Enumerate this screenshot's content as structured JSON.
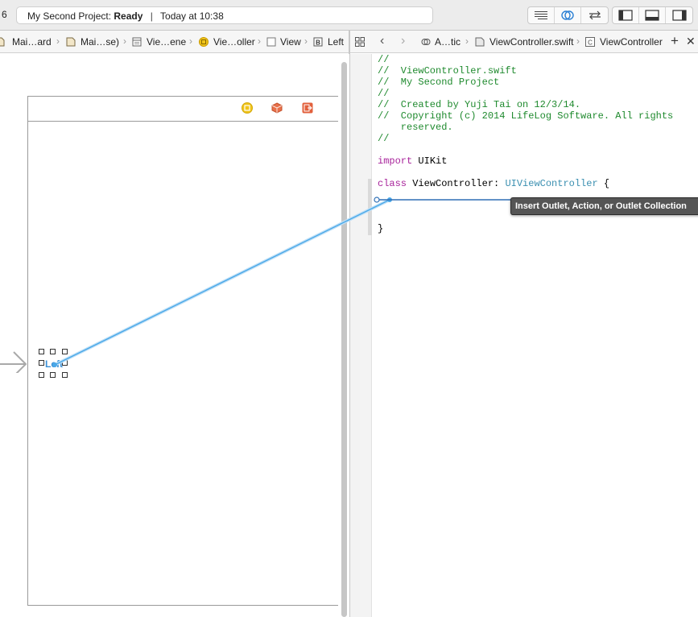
{
  "toolbar": {
    "scheme_number": "6",
    "status_project": "My Second Project:",
    "status_state": "Ready",
    "status_separator": "|",
    "status_time": "Today at 10:38"
  },
  "jumpbar_left": {
    "crumbs": [
      "Mai…ard",
      "Mai…se)",
      "Vie…ene",
      "Vie…oller",
      "View",
      "Left"
    ]
  },
  "jumpbar_right": {
    "crumbs": [
      "A…tic",
      "ViewController.swift",
      "ViewController"
    ]
  },
  "canvas": {
    "label_text": "Left"
  },
  "code": {
    "lines": [
      "//",
      "//  ViewController.swift",
      "//  My Second Project",
      "//",
      "//  Created by Yuji Tai on 12/3/14.",
      "//  Copyright (c) 2014 LifeLog Software. All rights",
      "    reserved.",
      "//"
    ],
    "import_keyword": "import",
    "import_module": " UIKit",
    "class_keyword": "class",
    "class_name": " ViewController: ",
    "superclass": "UIViewController",
    "open_brace": " {",
    "close_brace": "}"
  },
  "tooltip": {
    "text": "Insert Outlet, Action, or Outlet Collection"
  },
  "colors": {
    "connection": "#4aa8e8",
    "comment": "#1f8a2e",
    "keyword": "#a8239b",
    "type": "#3a8fb0"
  }
}
